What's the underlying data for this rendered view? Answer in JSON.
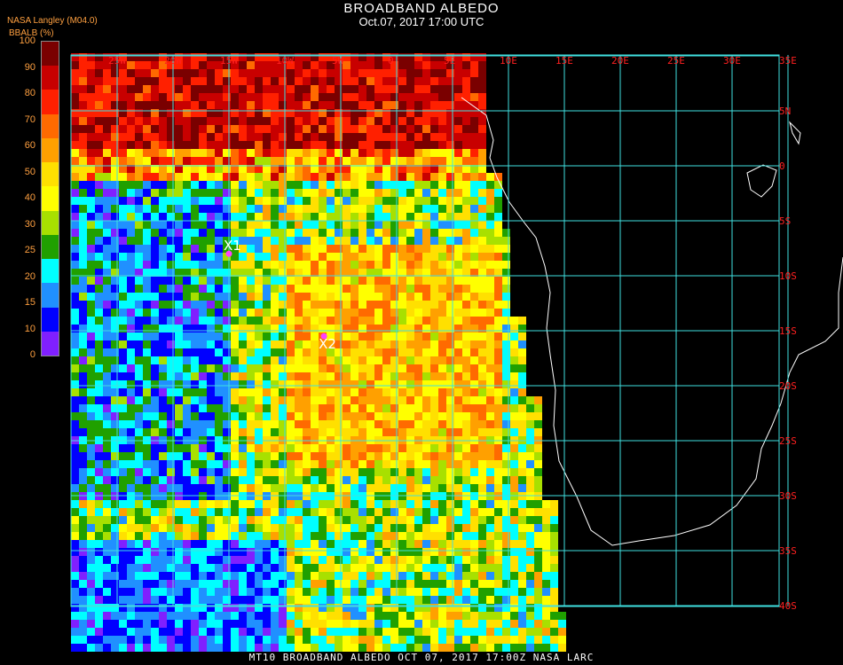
{
  "header": {
    "title": "BROADBAND ALBEDO",
    "subtitle": "Oct.07, 2017 17:00 UTC"
  },
  "legend": {
    "source": "NASA Langley (M04.0)",
    "parameter": "BBALB (%)",
    "ticks": [
      "100",
      "90",
      "80",
      "70",
      "60",
      "50",
      "40",
      "30",
      "25",
      "20",
      "15",
      "10",
      "0"
    ],
    "colors": [
      "#7a0000",
      "#c80000",
      "#ff2000",
      "#ff6a00",
      "#ffa000",
      "#ffe000",
      "#ffff00",
      "#a8e000",
      "#20a000",
      "#00ffff",
      "#2090ff",
      "#0000ff",
      "#8020ff"
    ]
  },
  "map": {
    "lon_labels": [
      "25W",
      "20W",
      "15W",
      "10W",
      "5W",
      "0",
      "5E",
      "10E",
      "15E",
      "20E",
      "25E",
      "30E",
      "35E"
    ],
    "lat_labels": [
      "5N",
      "0",
      "5S",
      "10S",
      "15S",
      "20S",
      "25S",
      "30S",
      "35S",
      "40S"
    ],
    "grid_color": "#40e0e0",
    "label_color": "#ff2020",
    "markers": [
      {
        "label": "X1",
        "lon": -15.0,
        "lat": -8.0
      },
      {
        "label": "X2",
        "lon": -6.5,
        "lat": -15.5
      }
    ]
  },
  "footer": "MT10  BROADBAND ALBEDO   OCT 07, 2017 17:00Z   NASA LARC"
}
